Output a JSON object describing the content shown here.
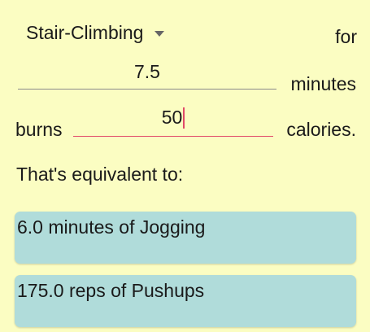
{
  "activity": {
    "selected": "Stair-Climbing",
    "for_label": "for"
  },
  "minutes": {
    "value": "7.5",
    "unit": "minutes"
  },
  "calories": {
    "prefix": "burns",
    "value": "50",
    "unit": "calories."
  },
  "equivalents": {
    "heading": "That's equivalent to:",
    "items": [
      "6.0 minutes of Jogging",
      "175.0 reps of Pushups"
    ]
  },
  "colors": {
    "background": "#fbfdc2",
    "card": "#b0dcda",
    "focused_underline": "#e04a6a",
    "underline": "#8a8a8a"
  }
}
